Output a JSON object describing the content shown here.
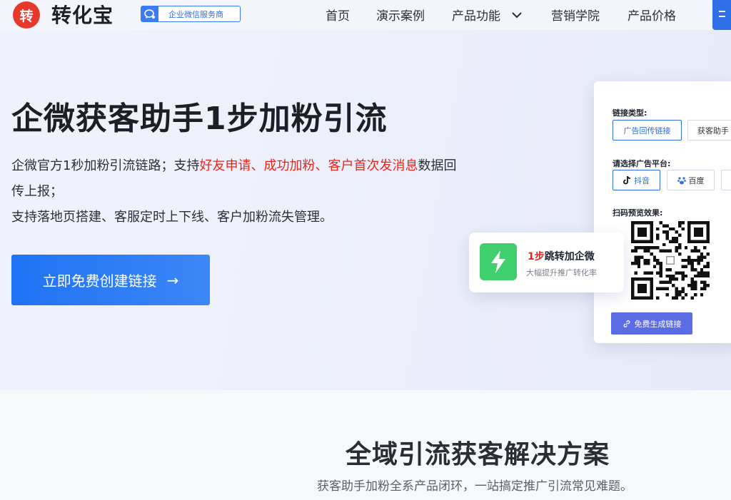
{
  "header": {
    "logo_mark": "转",
    "logo_text": "转化宝",
    "badge_text": "企业微信服务商",
    "nav": [
      {
        "label": "首页"
      },
      {
        "label": "演示案例"
      },
      {
        "label": "产品功能",
        "has_dropdown": true
      },
      {
        "label": "营销学院"
      },
      {
        "label": "产品价格"
      }
    ]
  },
  "hero": {
    "title": "企微获客助手1步加粉引流",
    "desc_part1": "企微官方1秒加粉引流链路；支持",
    "desc_highlight": "好友申请、成功加粉、客户首次发消息",
    "desc_part2": "数据回传上报；",
    "desc_line3": "支持落地页搭建、客服定时上下线、客户加粉流失管理。",
    "cta_label": "立即免费创建链接",
    "cta_arrow": "→"
  },
  "demo_card": {
    "link_type_label": "链接类型:",
    "link_types": [
      "广告回传链接",
      "获客助手"
    ],
    "platform_label": "请选择广告平台:",
    "platforms": [
      "抖音",
      "百度"
    ],
    "preview_label": "扫码预览效果:",
    "generate_label": "免费生成链接"
  },
  "float_card": {
    "title_highlight": "1步",
    "title_rest": "跳转加企微",
    "subtitle": "大幅提升推广转化率"
  },
  "section": {
    "title": "全域引流获客解决方案",
    "subtitle": "获客助手加粉全系产品闭环，一站搞定推广引流常见难题。"
  },
  "colors": {
    "brand_red": "#e8382c",
    "primary_blue": "#2f6fe8",
    "highlight_red": "#e8261c",
    "bolt_green": "#3fcf6d",
    "generate_purple": "#5b6ce4"
  }
}
